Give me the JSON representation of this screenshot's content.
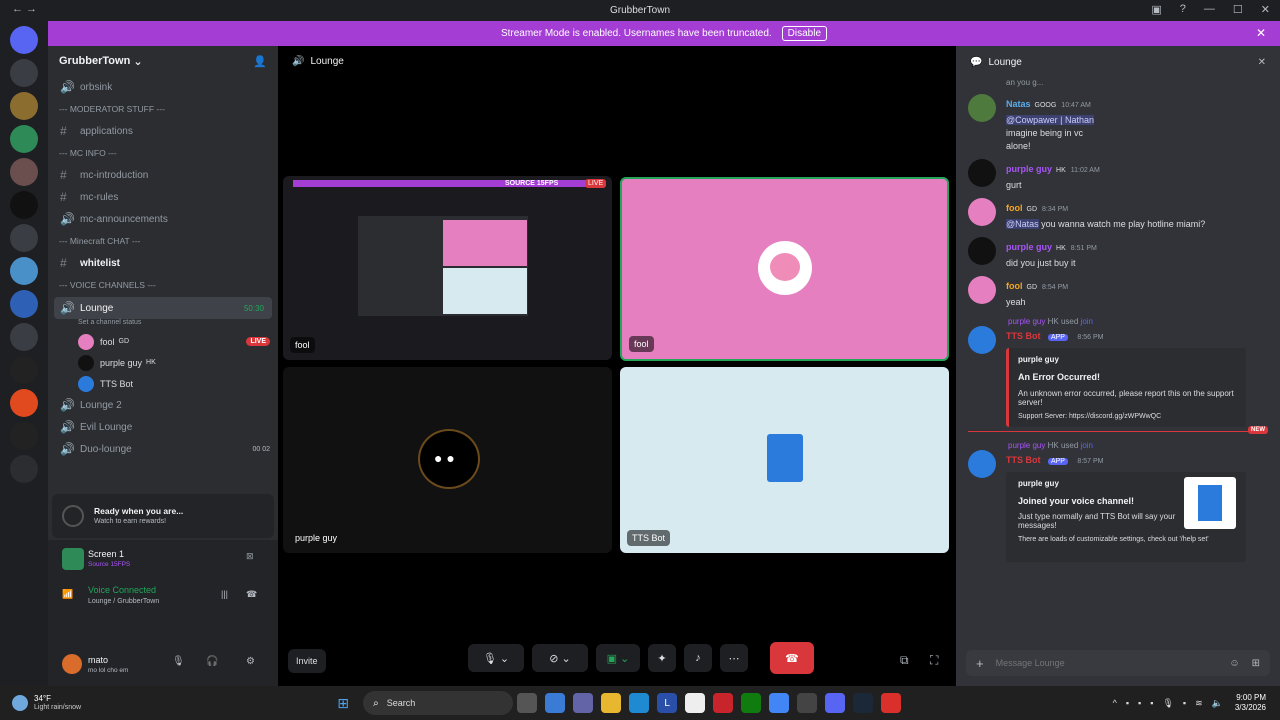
{
  "window": {
    "title": "GrubberTown"
  },
  "banner": {
    "text": "Streamer Mode is enabled. Usernames have been truncated.",
    "disable_label": "Disable"
  },
  "sidebar": {
    "server_name": "GrubberTown",
    "rows": [
      {
        "kind": "channel",
        "icon": "speaker",
        "label": "orbsink"
      },
      {
        "kind": "category",
        "label": "--- MODERATOR STUFF ---"
      },
      {
        "kind": "channel",
        "icon": "hash",
        "label": "applications"
      },
      {
        "kind": "category",
        "label": "--- MC INFO ---"
      },
      {
        "kind": "channel",
        "icon": "hash",
        "label": "mc-introduction"
      },
      {
        "kind": "channel",
        "icon": "hash",
        "label": "mc-rules"
      },
      {
        "kind": "channel",
        "icon": "speaker",
        "label": "mc-announcements"
      },
      {
        "kind": "category",
        "label": "--- Minecraft CHAT ---"
      },
      {
        "kind": "channel",
        "icon": "hash",
        "label": "whitelist"
      },
      {
        "kind": "category",
        "label": "--- VOICE CHANNELS ---"
      }
    ],
    "lounge": {
      "name": "Lounge",
      "time": "50:30",
      "status": "Set a channel status"
    },
    "voice_users": [
      {
        "name": "fool",
        "badge": "GD",
        "live": "LIVE"
      },
      {
        "name": "purple guy",
        "badge": "HK",
        "live": ""
      },
      {
        "name": "TTS Bot",
        "badge": "",
        "live": ""
      }
    ],
    "other_channels": [
      {
        "label": "Lounge 2",
        "meta": ""
      },
      {
        "label": "Evil Lounge",
        "meta": ""
      },
      {
        "label": "Duo-lounge",
        "meta": "00 02"
      }
    ],
    "ready": {
      "title": "Ready when you are...",
      "subtitle": "Watch to earn rewards!"
    },
    "screen": {
      "title": "Screen 1",
      "subtitle": "Source 15FPS"
    },
    "voice": {
      "status": "Voice Connected",
      "location": "Lounge / GrubberTown"
    },
    "user": {
      "name": "mato",
      "status": "mo lol cho em"
    }
  },
  "vc": {
    "header": "Lounge",
    "source_badge": "SOURCE 15FPS",
    "live_badge": "LIVE",
    "tiles": {
      "stream": "fool",
      "fool": "fool",
      "purple": "purple guy",
      "tts": "TTS Bot"
    },
    "invite": "Invite"
  },
  "chat": {
    "header": "Lounge",
    "partial_top": "an you g...",
    "messages": [
      {
        "name": "Natas",
        "tag": "GOOG",
        "time": "10:47 AM",
        "mention": "@Cowpawer | Nathan",
        "lines": [
          "imagine being in vc",
          "alone!"
        ],
        "color": "#5dadec"
      },
      {
        "name": "purple guy",
        "tag": "HK",
        "time": "11:02 AM",
        "mention": "",
        "lines": [
          "gurt"
        ],
        "color": "#a855f7"
      },
      {
        "name": "fool",
        "tag": "GD",
        "time": "8:34 PM",
        "mention": "@Natas",
        "lines": [
          "you wanna watch me play hotline miami?"
        ],
        "color": "#f5a623"
      },
      {
        "name": "purple guy",
        "tag": "HK",
        "time": "8:51 PM",
        "mention": "",
        "lines": [
          "did you just buy it"
        ],
        "color": "#a855f7"
      },
      {
        "name": "fool",
        "tag": "GD",
        "time": "8:54 PM",
        "mention": "",
        "lines": [
          "yeah"
        ],
        "color": "#f5a623"
      }
    ],
    "bot1": {
      "used_by": "purple guy",
      "used_tag": "HK",
      "used": "used",
      "cmd": "join",
      "name": "TTS Bot",
      "app": "APP",
      "time": "8:56 PM",
      "embed_author": "purple guy",
      "embed_title": "An Error Occurred!",
      "embed_text": "An unknown error occurred, please report this on the support server!",
      "embed_footer": "Support Server: https://discord.gg/zWPWwQC"
    },
    "new_label": "NEW",
    "bot2": {
      "used_by": "purple guy",
      "used_tag": "HK",
      "used": "used",
      "cmd": "join",
      "name": "TTS Bot",
      "app": "APP",
      "time": "8:57 PM",
      "embed_author": "purple guy",
      "embed_title": "Joined your voice channel!",
      "embed_text": "Just type normally and TTS Bot will say your messages!",
      "embed_footer": "There are loads of customizable settings, check out '/help set'"
    },
    "input_placeholder": "Message Lounge"
  },
  "taskbar": {
    "weather_temp": "34°F",
    "weather_desc": "Light rain/snow",
    "search": "Search",
    "time": "9:00 PM",
    "date": "3/3/2026"
  },
  "colors": {
    "accent": "#5865f2",
    "banner": "#a43dd3",
    "live": "#da373c",
    "fool_bg": "#e57fbf",
    "tts_bg": "#d7eaf0",
    "voice_green": "#23a55a"
  }
}
